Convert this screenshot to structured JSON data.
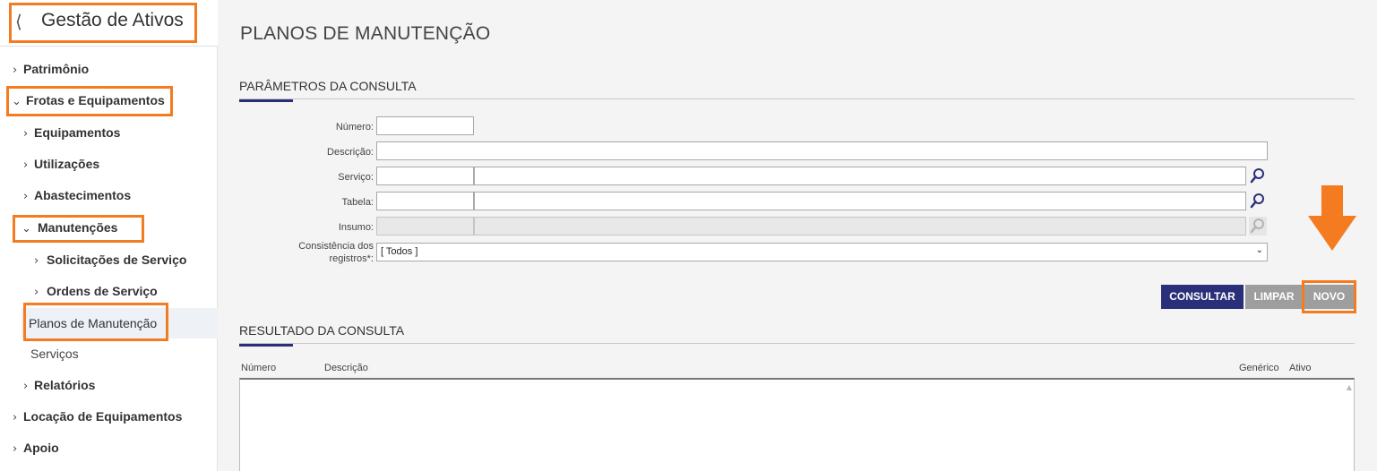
{
  "sidebar": {
    "back_icon": "chevron-left-icon",
    "title": "Gestão de Ativos",
    "items": [
      {
        "label": "Patrimônio",
        "chevron": ">"
      },
      {
        "label": "Frotas e Equipamentos",
        "chevron": "v"
      },
      {
        "label": "Equipamentos",
        "chevron": ">"
      },
      {
        "label": "Utilizações",
        "chevron": ">"
      },
      {
        "label": "Abastecimentos",
        "chevron": ">"
      },
      {
        "label": "Manutenções",
        "chevron": "v"
      },
      {
        "label": "Solicitações de Serviço",
        "chevron": ">"
      },
      {
        "label": "Ordens de Serviço",
        "chevron": ">"
      },
      {
        "label": "Planos de Manutenção",
        "chevron": ""
      },
      {
        "label": "Serviços",
        "chevron": ""
      },
      {
        "label": "Relatórios",
        "chevron": ">"
      },
      {
        "label": "Locação de Equipamentos",
        "chevron": ">"
      },
      {
        "label": "Apoio",
        "chevron": ">"
      }
    ]
  },
  "main": {
    "page_title": "PLANOS DE MANUTENÇÃO",
    "params_title": "PARÂMETROS DA CONSULTA",
    "form": {
      "numero_label": "Número:",
      "descricao_label": "Descrição:",
      "servico_label": "Serviço:",
      "tabela_label": "Tabela:",
      "insumo_label": "Insumo:",
      "consistencia_label_1": "Consistência dos",
      "consistencia_label_2": "registros*:",
      "consistencia_value": "[ Todos ]"
    },
    "buttons": {
      "consultar": "CONSULTAR",
      "limpar": "LIMPAR",
      "novo": "NOVO"
    },
    "results_title": "RESULTADO DA CONSULTA",
    "columns": [
      "Número",
      "Descrição",
      "Genérico",
      "Ativo"
    ]
  },
  "colors": {
    "highlight": "#f47b20",
    "primary_button": "#2a2f7a",
    "disabled_button": "#9e9e9e",
    "search_icon": "#2a2f7a"
  }
}
